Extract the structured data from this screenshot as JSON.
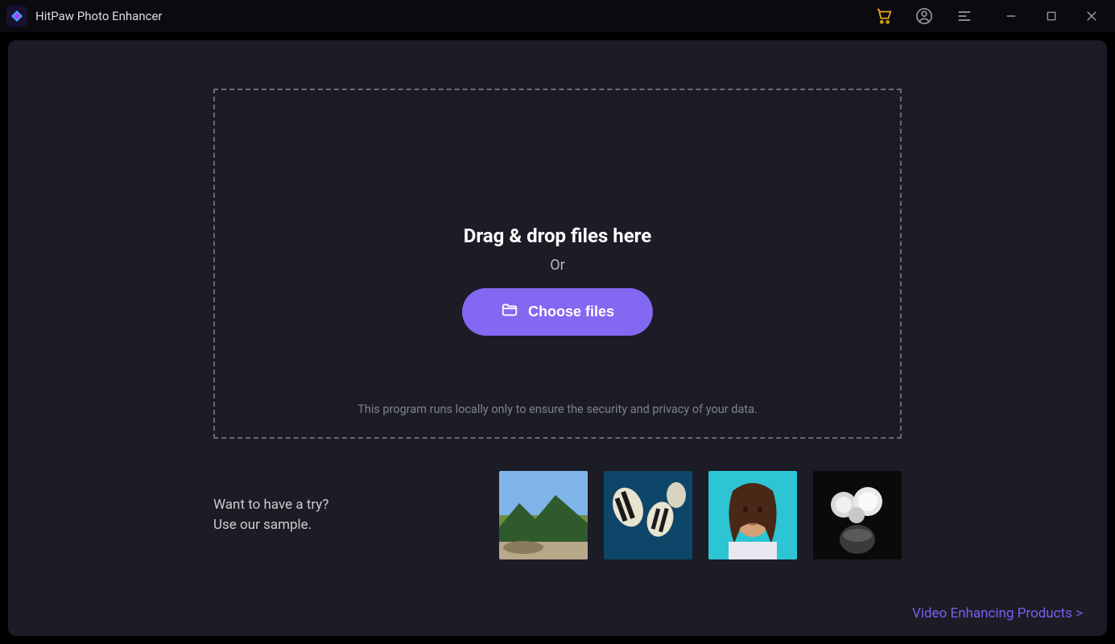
{
  "app": {
    "title": "HitPaw Photo Enhancer"
  },
  "dropzone": {
    "heading": "Drag & drop files here",
    "or": "Or",
    "choose_label": "Choose files",
    "privacy": "This program runs locally only to ensure the security and privacy of your data."
  },
  "sample": {
    "line1": "Want to have a try?",
    "line2": "Use our sample."
  },
  "thumbs": [
    {
      "name": "sample-landscape"
    },
    {
      "name": "sample-fish"
    },
    {
      "name": "sample-portrait"
    },
    {
      "name": "sample-flowers"
    }
  ],
  "footer": {
    "link": "Video Enhancing Products >"
  }
}
